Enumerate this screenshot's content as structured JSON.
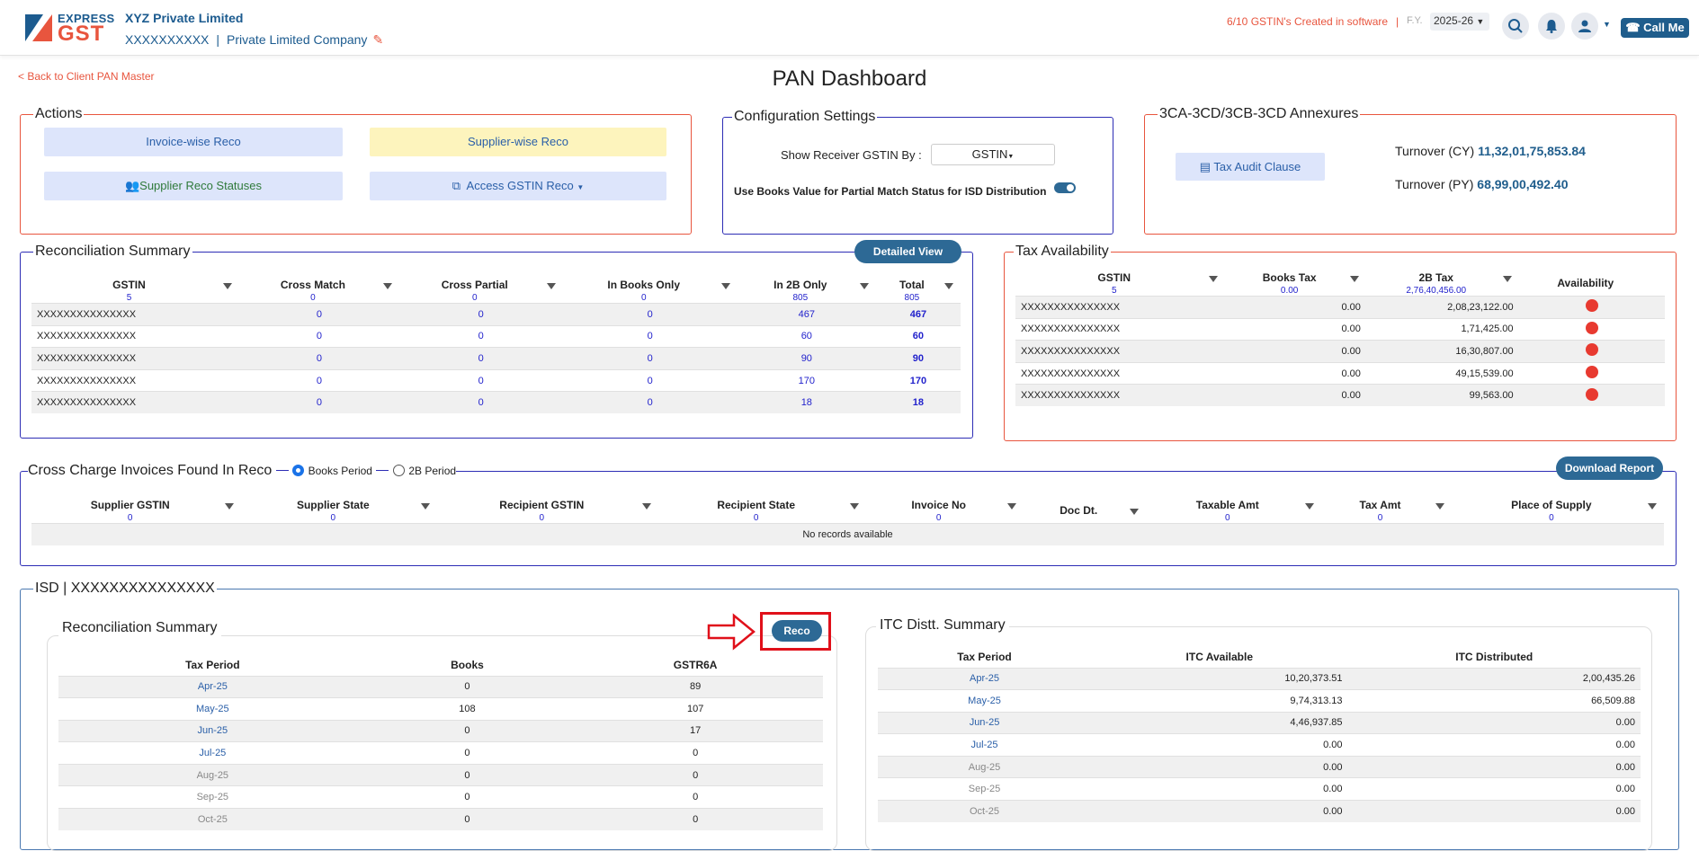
{
  "header": {
    "logo_express": "EXPRESS",
    "logo_gst": "GST",
    "company_name": "XYZ Private Limited",
    "company_pan": "XXXXXXXXXX",
    "company_type": "Private Limited Company",
    "gstin_count": "6/10 GSTIN's Created in software",
    "fy_label": "F.Y.",
    "fy_value": "2025-26",
    "call_me": "Call Me"
  },
  "back_link": "< Back to Client PAN Master",
  "page_title": "PAN Dashboard",
  "actions": {
    "legend": "Actions",
    "invoice_reco": "Invoice-wise Reco",
    "supplier_reco": "Supplier-wise Reco",
    "supplier_statuses": "Supplier Reco Statuses",
    "access_gstin_reco": "Access GSTIN Reco"
  },
  "config": {
    "legend": "Configuration Settings",
    "show_receiver_label": "Show Receiver GSTIN By :",
    "show_receiver_value": "GSTIN",
    "books_value_label": "Use Books Value for Partial Match Status for ISD Distribution"
  },
  "annexures": {
    "legend": "3CA-3CD/3CB-3CD Annexures",
    "tax_audit": "Tax Audit Clause",
    "turnover_cy_label": "Turnover (CY)",
    "turnover_cy": "11,32,01,75,853.84",
    "turnover_py_label": "Turnover (PY)",
    "turnover_py": "68,99,00,492.40"
  },
  "reco_summary": {
    "legend": "Reconciliation Summary",
    "detailed_view": "Detailed View",
    "headers": [
      "GSTIN",
      "Cross Match",
      "Cross Partial",
      "In Books Only",
      "In 2B Only",
      "Total"
    ],
    "counts": [
      "5",
      "0",
      "0",
      "0",
      "805",
      "805"
    ],
    "rows": [
      [
        "XXXXXXXXXXXXXXX",
        "0",
        "0",
        "0",
        "467",
        "467"
      ],
      [
        "XXXXXXXXXXXXXXX",
        "0",
        "0",
        "0",
        "60",
        "60"
      ],
      [
        "XXXXXXXXXXXXXXX",
        "0",
        "0",
        "0",
        "90",
        "90"
      ],
      [
        "XXXXXXXXXXXXXXX",
        "0",
        "0",
        "0",
        "170",
        "170"
      ],
      [
        "XXXXXXXXXXXXXXX",
        "0",
        "0",
        "0",
        "18",
        "18"
      ]
    ]
  },
  "tax_availability": {
    "legend": "Tax Availability",
    "headers": [
      "GSTIN",
      "Books Tax",
      "2B Tax",
      "Availability"
    ],
    "counts": [
      "5",
      "0.00",
      "2,76,40,456.00",
      ""
    ],
    "rows": [
      [
        "XXXXXXXXXXXXXXX",
        "0.00",
        "2,08,23,122.00"
      ],
      [
        "XXXXXXXXXXXXXXX",
        "0.00",
        "1,71,425.00"
      ],
      [
        "XXXXXXXXXXXXXXX",
        "0.00",
        "16,30,807.00"
      ],
      [
        "XXXXXXXXXXXXXXX",
        "0.00",
        "49,15,539.00"
      ],
      [
        "XXXXXXXXXXXXXXX",
        "0.00",
        "99,563.00"
      ]
    ],
    "status_color": "#e83a30"
  },
  "cross_charge": {
    "legend": "Cross Charge Invoices Found In Reco",
    "radio_books": "Books Period",
    "radio_2b": "2B Period",
    "download": "Download Report",
    "headers": [
      "Supplier GSTIN",
      "Supplier State",
      "Recipient GSTIN",
      "Recipient State",
      "Invoice No",
      "Doc Dt.",
      "Taxable Amt",
      "Tax Amt",
      "Place of Supply"
    ],
    "counts": [
      "0",
      "0",
      "0",
      "0",
      "0",
      "",
      "0",
      "0",
      "0"
    ],
    "empty": "No records available"
  },
  "isd": {
    "legend": "ISD | XXXXXXXXXXXXXXX",
    "reco": {
      "legend": "Reconciliation Summary",
      "button": "Reco",
      "headers": [
        "Tax Period",
        "Books",
        "GSTR6A"
      ],
      "rows": [
        [
          "Apr-25",
          "0",
          "89"
        ],
        [
          "May-25",
          "108",
          "107"
        ],
        [
          "Jun-25",
          "0",
          "17"
        ],
        [
          "Jul-25",
          "0",
          "0"
        ],
        [
          "Aug-25",
          "0",
          "0"
        ],
        [
          "Sep-25",
          "0",
          "0"
        ],
        [
          "Oct-25",
          "0",
          "0"
        ]
      ]
    },
    "itc": {
      "legend": "ITC Distt. Summary",
      "headers": [
        "Tax Period",
        "ITC Available",
        "ITC Distributed"
      ],
      "rows": [
        [
          "Apr-25",
          "10,20,373.51",
          "2,00,435.26"
        ],
        [
          "May-25",
          "9,74,313.13",
          "66,509.88"
        ],
        [
          "Jun-25",
          "4,46,937.85",
          "0.00"
        ],
        [
          "Jul-25",
          "0.00",
          "0.00"
        ],
        [
          "Aug-25",
          "0.00",
          "0.00"
        ],
        [
          "Sep-25",
          "0.00",
          "0.00"
        ],
        [
          "Oct-25",
          "0.00",
          "0.00"
        ]
      ]
    }
  },
  "colors": {
    "brand_blue": "#1f5d8c",
    "accent_red": "#e8553e",
    "highlight": "#e0101a"
  }
}
